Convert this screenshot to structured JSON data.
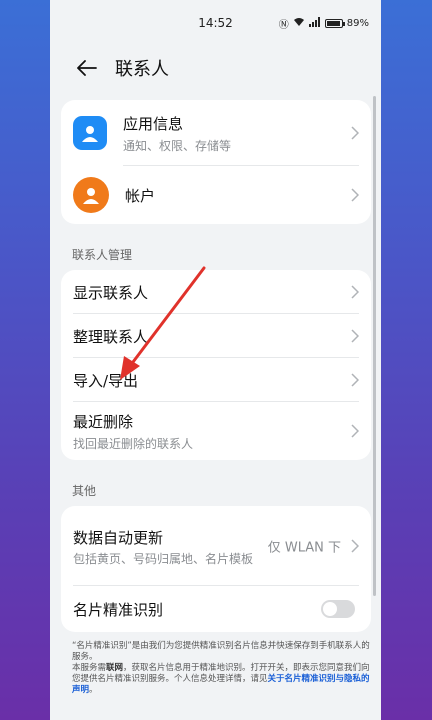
{
  "status_bar": {
    "time": "14:52",
    "battery": "89%"
  },
  "header": {
    "title": "联系人"
  },
  "top_card": {
    "items": [
      {
        "title": "应用信息",
        "subtitle": "通知、权限、存储等"
      },
      {
        "title": "帐户"
      }
    ]
  },
  "section_manage": {
    "label": "联系人管理",
    "items": [
      {
        "title": "显示联系人"
      },
      {
        "title": "整理联系人"
      },
      {
        "title": "导入/导出"
      },
      {
        "title": "最近删除",
        "subtitle": "找回最近删除的联系人"
      }
    ]
  },
  "section_other": {
    "label": "其他",
    "auto_update": {
      "title": "数据自动更新",
      "subtitle": "包括黄页、号码归属地、名片模板",
      "value": "仅 WLAN 下"
    },
    "card_recognition": {
      "title": "名片精准识别",
      "enabled": false
    }
  },
  "footnote": {
    "line1": "“名片精准识别”是由我们为您提供精准识别名片信息并快速保存到手机联系人的服务。",
    "line2_pre": "本服务需",
    "line2_bold": "联网",
    "line2_post": "，获取名片信息用于精准地识别。打开开关，即表示您同意我们向您提供名片精准识别服务。个人信息处理详情，请见",
    "link": "关于名片精准识别与隐私的声明",
    "end": "。"
  },
  "colors": {
    "app_icon": "#1f8cf5",
    "account_icon": "#f07a1a",
    "annotation_arrow": "#e0322b"
  }
}
